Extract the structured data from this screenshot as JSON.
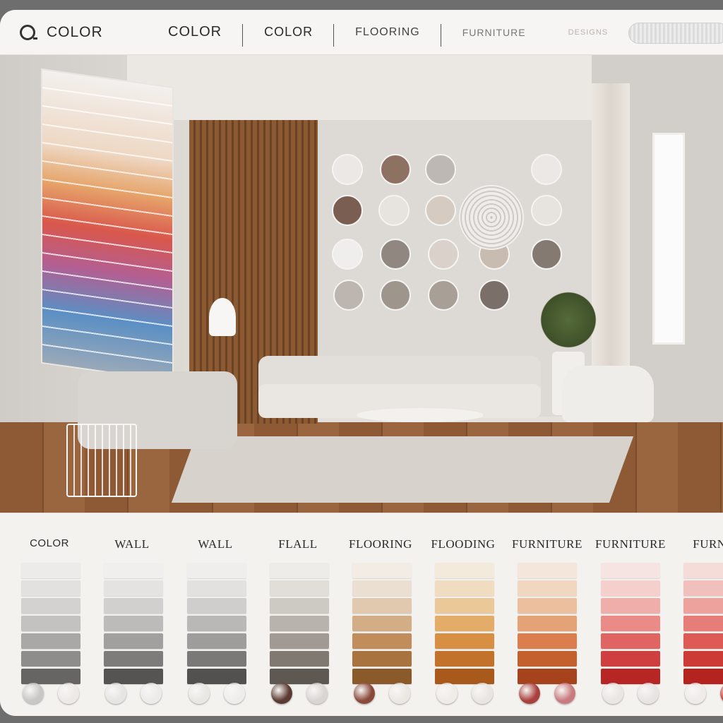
{
  "topbar": {
    "brand_label": "COLOR",
    "tabs": [
      {
        "label": "COLOR"
      },
      {
        "label": "COLOR"
      },
      {
        "label": "FLOORING"
      },
      {
        "label": "FURNITURE"
      },
      {
        "label": "DESIGNS"
      }
    ]
  },
  "palette": {
    "columns": [
      {
        "title": "COLOR",
        "swatches": [
          "#ecebe9",
          "#e2e1df",
          "#d3d2d0",
          "#c3c2c0",
          "#a9a8a6",
          "#8e8d8b",
          "#666564"
        ],
        "knobs": [
          "#c9c7c5",
          "#ece9e6"
        ]
      },
      {
        "title": "WALL",
        "swatches": [
          "#f0efed",
          "#e4e3e1",
          "#d1d0ce",
          "#bcbbb9",
          "#a1a09e",
          "#7d7c7a",
          "#555453"
        ],
        "knobs": [
          "#e7e5e3",
          "#ecebe9"
        ]
      },
      {
        "title": "WALL",
        "swatches": [
          "#efeeec",
          "#e2e1df",
          "#cfcecc",
          "#b9b8b6",
          "#9e9d9b",
          "#7a7977",
          "#525150"
        ],
        "knobs": [
          "#e9e7e4",
          "#efedeb"
        ]
      },
      {
        "title": "FLALL",
        "swatches": [
          "#eeece8",
          "#e1ddd8",
          "#cdc9c3",
          "#b8b3ad",
          "#a09a93",
          "#7f7972",
          "#5e5852"
        ],
        "knobs": [
          "#5a3b32",
          "#d8d5d2"
        ]
      },
      {
        "title": "FLOORING",
        "swatches": [
          "#f2ece4",
          "#ebdfd1",
          "#e0c9ae",
          "#d2ad86",
          "#c08d5b",
          "#a8733f",
          "#8b5a2b"
        ],
        "knobs": [
          "#8a4a3a",
          "#ebe8e4"
        ]
      },
      {
        "title": "FLOODING",
        "swatches": [
          "#f4eadc",
          "#f0dcc0",
          "#ebc897",
          "#e3ad69",
          "#d78f44",
          "#c2722a",
          "#a9591c"
        ],
        "knobs": [
          "#efece8",
          "#e9e6e2"
        ]
      },
      {
        "title": "FURNITURE",
        "swatches": [
          "#f4e6da",
          "#f1d6c0",
          "#ecc09e",
          "#e5a277",
          "#d97e4c",
          "#c4602e",
          "#a6421c"
        ],
        "knobs": [
          "#a9403d",
          "#c97a7e"
        ]
      },
      {
        "title": "FURNITURE",
        "swatches": [
          "#f6e4e2",
          "#f4cfcc",
          "#f0aeab",
          "#ea8b87",
          "#e06462",
          "#cf3f3f",
          "#b72525"
        ],
        "knobs": [
          "#e9e6e3",
          "#e7e4e1"
        ]
      },
      {
        "title": "FURNI",
        "swatches": [
          "#f6dcd9",
          "#f2c0bc",
          "#eea29d",
          "#e77d78",
          "#dd5a55",
          "#cd3b37",
          "#b52320"
        ],
        "knobs": [
          "#eeebe8",
          "#c43a33"
        ]
      }
    ]
  },
  "colors": {
    "accent_dark": "#2a2a2a",
    "panel_bg": "#f4f2ef",
    "wood": "#8b5a33"
  }
}
